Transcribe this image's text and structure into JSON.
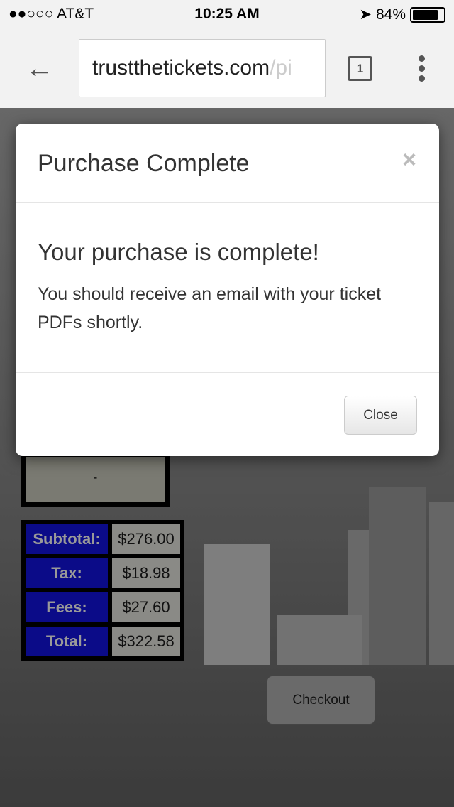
{
  "status": {
    "carrier": "●●○○○ AT&T",
    "time": "10:25 AM",
    "battery": "84%",
    "battery_level": 0.84
  },
  "browser": {
    "url_main": "trustthetickets.com",
    "url_rest": "/pi",
    "tab_count": "1"
  },
  "page": {
    "box_value": "-",
    "summary": [
      {
        "label": "Subtotal:",
        "value": "$276.00"
      },
      {
        "label": "Tax:",
        "value": "$18.98"
      },
      {
        "label": "Fees:",
        "value": "$27.60"
      },
      {
        "label": "Total:",
        "value": "$322.58"
      }
    ],
    "checkout": "Checkout"
  },
  "modal": {
    "title": "Purchase Complete",
    "close_x": "×",
    "heading": "Your purchase is complete!",
    "body": "You should receive an email with your ticket PDFs shortly.",
    "close": "Close"
  }
}
